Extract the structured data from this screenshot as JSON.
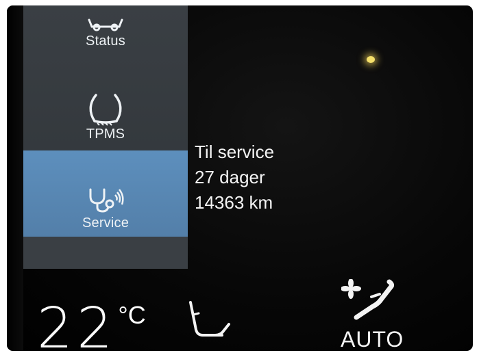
{
  "sidebar": {
    "items": [
      {
        "label": "Status",
        "icon": "car-icon"
      },
      {
        "label": "TPMS",
        "icon": "tire-pressure-icon"
      },
      {
        "label": "Service",
        "icon": "stethoscope-service-icon",
        "selected": true
      }
    ]
  },
  "info": {
    "line1": "Til service",
    "line2": "27 dager",
    "line3": "14363 km"
  },
  "climate": {
    "temperature": "22",
    "unit": "°C",
    "auto_label": "AUTO"
  },
  "colors": {
    "sidebar_bg": "#3a3f44",
    "selected_bg": "#5b8dbb",
    "screen_bg": "#050505",
    "text": "#f4f4f4"
  }
}
